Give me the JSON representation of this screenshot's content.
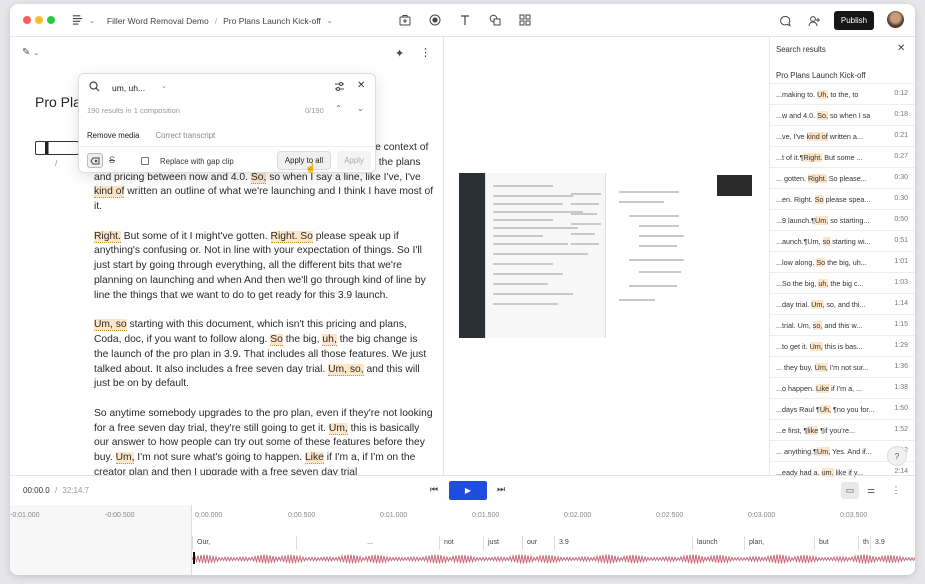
{
  "header": {
    "workspace": "Filler Word Removal Demo",
    "separator": "/",
    "doc_title": "Pro Plans Launch Kick-off",
    "publish_label": "Publish"
  },
  "editor": {
    "title": "Pro Plan",
    "speaker": "/",
    "paragraphs": [
      [
        {
          "t": "/",
          "c": "cursor"
        },
        {
          "t": "Our, not just our 3.9 launch plan, but the 3.9 launch plan in the context of the broader set of changes that we're making to. "
        },
        {
          "t": "Uh,",
          "c": "hl"
        },
        {
          "t": " to the, to the plans and pricing between now and 4.0. "
        },
        {
          "t": "So,",
          "c": "hl"
        },
        {
          "t": " so when I say a line, like I've, I've "
        },
        {
          "t": "kind of",
          "c": "hl"
        },
        {
          "t": " written an outline of what we're launching and I think I have most of it."
        }
      ],
      [
        {
          "t": "Right.",
          "c": "hl"
        },
        {
          "t": " But some of it I might've gotten. "
        },
        {
          "t": "Right. So",
          "c": "hl"
        },
        {
          "t": " please speak up if anything's confusing or. Not in line with your expectation of things. So I'll just start by going through everything, all the different bits that we're planning on launching and when And then we'll go through kind of line by line the things that we want to do to get ready for this 3.9 launch."
        }
      ],
      [
        {
          "t": "Um, so",
          "c": "hl"
        },
        {
          "t": " starting with this document, which isn't this pricing and plans, Coda, doc, if you want to follow along. "
        },
        {
          "t": "So",
          "c": "hl"
        },
        {
          "t": " the big, "
        },
        {
          "t": "uh,",
          "c": "hl"
        },
        {
          "t": " the big change is the launch of the pro plan in 3.9. That includes all those features. We just talked about. It also includes a free seven day trial. "
        },
        {
          "t": "Um, so,",
          "c": "hl"
        },
        {
          "t": " and this will just be on by default."
        }
      ],
      [
        {
          "t": "So anytime somebody upgrades to the pro plan, even if they're not looking for a free seven day trial, they're still going to get it. "
        },
        {
          "t": "Um,",
          "c": "hl"
        },
        {
          "t": " this is basically our answer to how people can try out some of these features before they buy. "
        },
        {
          "t": "Um,",
          "c": "hl"
        },
        {
          "t": " I'm not sure what's going to happen. "
        },
        {
          "t": "Like",
          "c": "hl"
        },
        {
          "t": " if I'm a, if I'm on the creator plan and then I upgrade with a free seven day trial"
        }
      ]
    ]
  },
  "search": {
    "query": "um, uh...",
    "summary": "190 results in 1 composition",
    "count": "0/190",
    "tab_remove": "Remove media",
    "tab_correct": "Correct transcript",
    "gap_clip_label": "Replace with gap clip",
    "apply_all_label": "Apply to all",
    "apply_label": "Apply"
  },
  "results": {
    "heading": "Search results",
    "composition": "Pro Plans Launch Kick-off",
    "items": [
      {
        "pre": "...making to. ",
        "m": "Uh,",
        "post": " to the, to",
        "time": "0:12"
      },
      {
        "pre": "...w and 4.0. ",
        "m": "So,",
        "post": " so when I sa",
        "time": "0:18"
      },
      {
        "pre": "...ve, I've ",
        "m": "kind of",
        "post": " written a...",
        "time": "0:21"
      },
      {
        "pre": "...t of it.¶",
        "m": "Right.",
        "post": " But some ...",
        "time": "0:27"
      },
      {
        "pre": "... gotten. ",
        "m": "Right.",
        "post": " So please...",
        "time": "0:30"
      },
      {
        "pre": "...en. Right. ",
        "m": "So",
        "post": " please spea...",
        "time": "0:30"
      },
      {
        "pre": "...9 launch.¶",
        "m": "Um,",
        "post": " so starting...",
        "time": "0:50"
      },
      {
        "pre": "...aunch.¶Um, ",
        "m": "so",
        "post": " starting wi...",
        "time": "0:51"
      },
      {
        "pre": "...low along. ",
        "m": "So",
        "post": " the big, uh...",
        "time": "1:01"
      },
      {
        "pre": "...So the big, ",
        "m": "uh,",
        "post": " the big c...",
        "time": "1:03"
      },
      {
        "pre": "...day trial. ",
        "m": "Um,",
        "post": " so, and thi...",
        "time": "1:14"
      },
      {
        "pre": "...trial. Um, ",
        "m": "so,",
        "post": " and this w...",
        "time": "1:15"
      },
      {
        "pre": "...to get it. ",
        "m": "Um,",
        "post": " this is bas...",
        "time": "1:29"
      },
      {
        "pre": "... they buy. ",
        "m": "Um,",
        "post": " I'm not sur...",
        "time": "1:36"
      },
      {
        "pre": "...o happen. ",
        "m": "Like",
        "post": " if I'm a, ...",
        "time": "1:38"
      },
      {
        "pre": "...days Raul ¶",
        "m": "Uh,",
        "post": " ¶no you for...",
        "time": "1:50"
      },
      {
        "pre": "...e first, ¶",
        "m": "like",
        "post": " ¶if you're...",
        "time": "1:52"
      },
      {
        "pre": "... anything.¶",
        "m": "Um,",
        "post": " Yes. And if...",
        "time": "2:12"
      },
      {
        "pre": "...eady had a, ",
        "m": "um,",
        "post": " like if y...",
        "time": "2:14"
      }
    ]
  },
  "transport": {
    "current": "00:00.0",
    "sep": "/",
    "total": "32:14.7"
  },
  "timeline": {
    "ticks": [
      "-0:01.000",
      "-0:00.500",
      "0:00.000",
      "0:00.500",
      "0:01.000",
      "0:01.500",
      "0:02.000",
      "0:02.500",
      "0:03.000",
      "0:03.500"
    ],
    "words": [
      "Our,",
      "...",
      "not",
      "just",
      "our",
      "3.9",
      "launch",
      "plan,",
      "but",
      "th",
      "3.9"
    ]
  },
  "icons": {
    "close": "close-icon",
    "search": "search-icon",
    "settings": "sliders-icon"
  },
  "colors": {
    "highlight": "#fde5c7",
    "accent": "#1f4de0",
    "publish": "#161616"
  }
}
